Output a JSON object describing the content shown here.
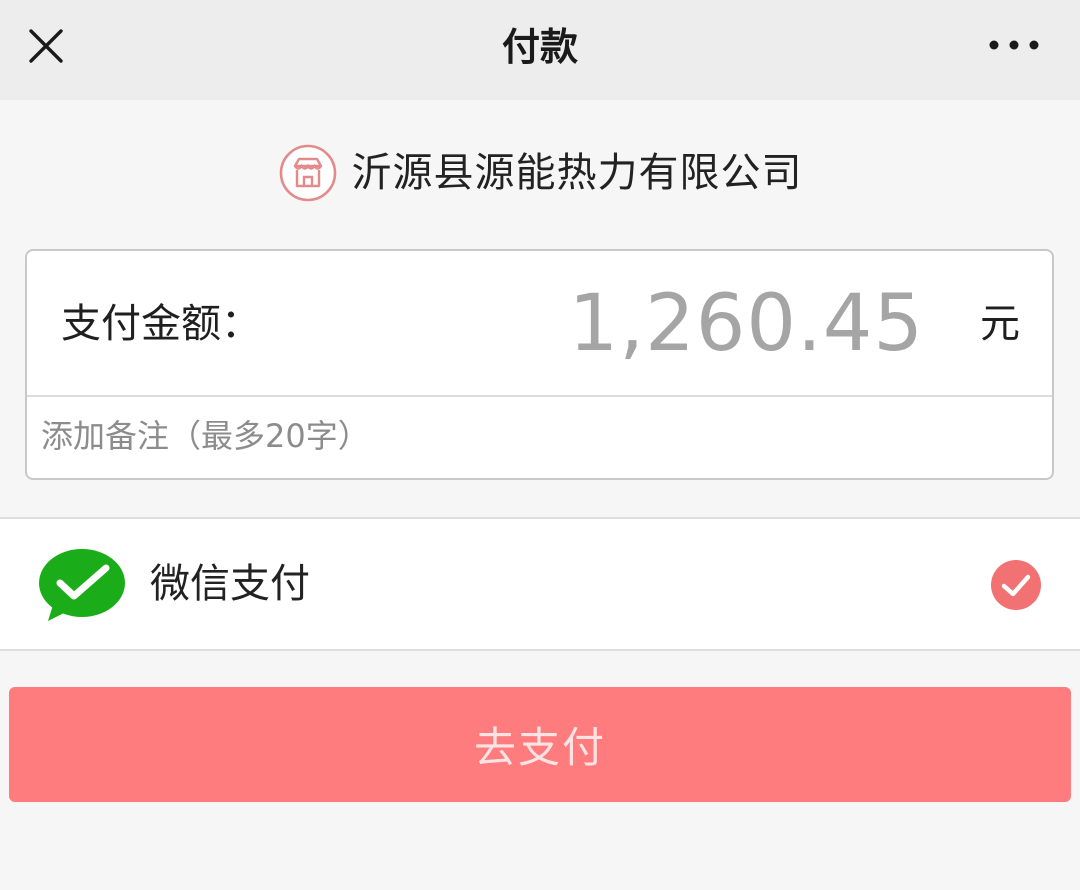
{
  "header": {
    "title": "付款",
    "close_icon": "close-icon",
    "more_icon": "more-icon"
  },
  "merchant": {
    "icon": "shop-icon",
    "name": "沂源县源能热力有限公司"
  },
  "amount": {
    "label": "支付金额：",
    "value": "1,260.45",
    "unit": "元"
  },
  "note": {
    "placeholder": "添加备注（最多20字）",
    "value": ""
  },
  "payment_method": {
    "icon": "wechat-pay-icon",
    "label": "微信支付",
    "selected": true,
    "check_icon": "checkmark-circle-icon"
  },
  "pay_button": {
    "label": "去支付"
  },
  "colors": {
    "accent": "#fe7b7e",
    "check": "#f27172",
    "wechat_green": "#1aad19",
    "amount_text": "#a5a5a5",
    "topbar_bg": "#ededed",
    "page_bg": "#f6f6f6"
  }
}
